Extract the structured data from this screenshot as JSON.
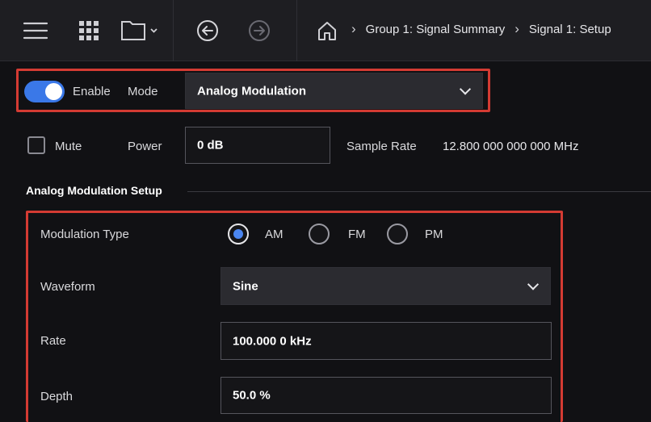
{
  "toolbar": {
    "icons": [
      "menu-icon",
      "apps-grid-icon",
      "folder-icon",
      "back-icon",
      "forward-icon",
      "home-icon"
    ],
    "breadcrumb": [
      "Group 1: Signal Summary",
      "Signal 1: Setup"
    ]
  },
  "signal": {
    "enable_label": "Enable",
    "enabled": true,
    "mode_label": "Mode",
    "mode_value": "Analog Modulation",
    "mute_label": "Mute",
    "mute_checked": false,
    "power_label": "Power",
    "power_value": "0 dB",
    "sample_rate_label": "Sample Rate",
    "sample_rate_value": "12.800 000 000 000 MHz"
  },
  "analog_setup": {
    "title": "Analog Modulation Setup",
    "modulation_type_label": "Modulation Type",
    "modulation_options": [
      "AM",
      "FM",
      "PM"
    ],
    "modulation_selected": "AM",
    "waveform_label": "Waveform",
    "waveform_value": "Sine",
    "rate_label": "Rate",
    "rate_value": "100.000 0 kHz",
    "depth_label": "Depth",
    "depth_value": "50.0 %"
  },
  "colors": {
    "accent": "#3a78e8",
    "highlight": "#d43b33",
    "background": "#111114",
    "toolbar": "#1e1e22"
  }
}
